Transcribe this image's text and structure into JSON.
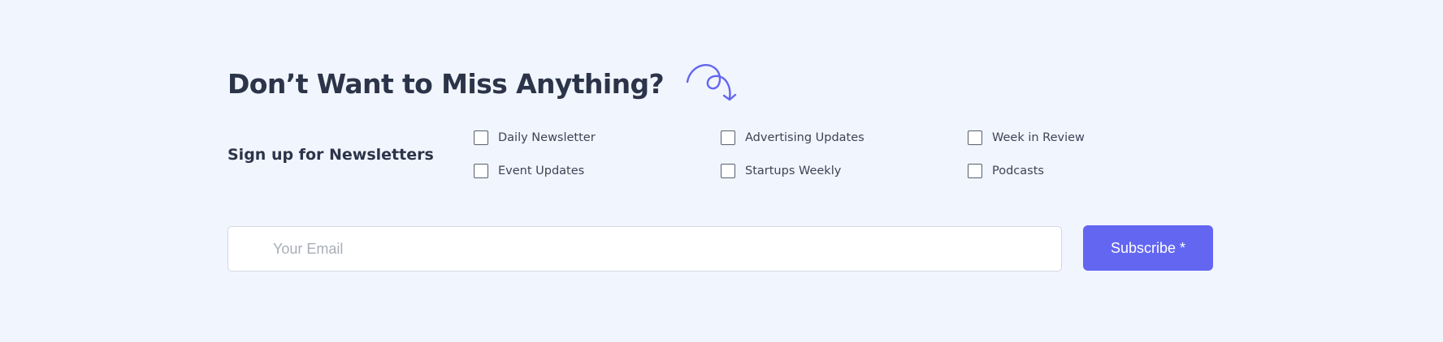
{
  "headline": "Don’t Want to Miss Anything?",
  "signup": {
    "label": "Sign up for Newsletters",
    "options": [
      {
        "label": "Daily Newsletter",
        "checked": false
      },
      {
        "label": "Advertising Updates",
        "checked": false
      },
      {
        "label": "Week in Review",
        "checked": false
      },
      {
        "label": "Event Updates",
        "checked": false
      },
      {
        "label": "Startups Weekly",
        "checked": false
      },
      {
        "label": "Podcasts",
        "checked": false
      }
    ]
  },
  "form": {
    "email_placeholder": "Your Email",
    "email_value": "",
    "subscribe_label": "Subscribe *"
  },
  "colors": {
    "background": "#f1f5fe",
    "heading": "#2b3448",
    "accent": "#6366f1"
  },
  "icons": {
    "decoration": "squiggle-arrow-icon"
  }
}
